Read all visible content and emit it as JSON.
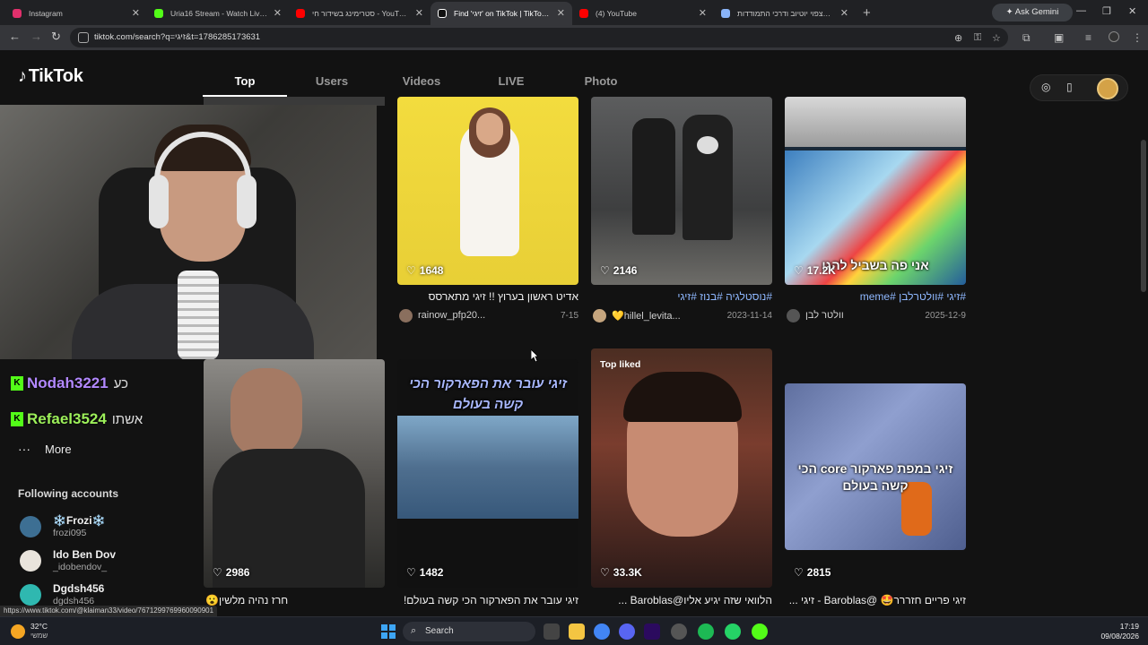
{
  "browser": {
    "tabs": [
      {
        "label": "Instagram",
        "color": "#e1306c"
      },
      {
        "label": "Uria16 Stream - Watch Live on Kick",
        "color": "#53fc18"
      },
      {
        "label": "סטרימינג בשידור חי - YouTube Studio",
        "color": "#ff0000"
      },
      {
        "label": "Find 'זיגי' on TikTok | TikTok Search",
        "color": "#ffffff"
      },
      {
        "label": "(4) YouTube",
        "color": "#ff0000"
      },
      {
        "label": "ירידה בצפוי יוטיוב ודרכי התמודדות",
        "color": "#8ab4f8"
      }
    ],
    "ask_gemini": "Ask Gemini",
    "url": "tiktok.com/search?q=זיגי&t=1786285173631",
    "status_url": "https://www.tiktok.com/@klaiman33/video/7671299769960090901"
  },
  "tiktok": {
    "logo": "TikTok",
    "search_tabs": [
      "Top",
      "Users",
      "Videos",
      "LIVE",
      "Photo"
    ],
    "active_tab": "Top",
    "sidebar": {
      "chat": [
        {
          "name": "Nodah3221",
          "msg": "כע"
        },
        {
          "name": "Refael3524",
          "msg": "אשתו"
        }
      ],
      "more": "More",
      "following_header": "Following accounts",
      "accounts": [
        {
          "name": "❄️Frozi❄️",
          "handle": "frozi095"
        },
        {
          "name": "Ido Ben Dov",
          "handle": "_idobendov_"
        },
        {
          "name": "Dgdsh456",
          "handle": "dgdsh456"
        }
      ]
    },
    "videos": [
      {
        "likes": "1648",
        "caption": "אדיט ראשון בערוץ !! זיגי מתארסס",
        "user": "rainow_pfp20...",
        "date": "7-15"
      },
      {
        "likes": "2146",
        "caption": "#נוסטלגיה #בנוז #זיגי",
        "user": "💛hillel_levita...",
        "date": "2023-11-14"
      },
      {
        "likes": "17.2K",
        "caption": "#זיגי #וולטרלבן #meme",
        "user": "וולטר לבן",
        "date": "2025-12-9",
        "overlay": "אני פה בשביל להגן"
      },
      {
        "likes": "2986",
        "caption": "חרז נהיה מלשין😮",
        "user": "",
        "date": ""
      },
      {
        "likes": "1482",
        "caption": "זיגי עובר את הפארקור הכי קשה בעולם!",
        "user": "",
        "date": "",
        "overlay": "זיגי עובר את הפארקור הכי קשה בעולם"
      },
      {
        "likes": "33.3K",
        "caption": "הלוואי שזה יגיע אליו@Baroblas ...",
        "user": "",
        "date": "",
        "badge": "Top liked"
      },
      {
        "likes": "2815",
        "caption": "זיגי פריים חזררר🤩 @Baroblas - זיגי ...",
        "user": "",
        "date": "",
        "overlay": "זיגי במפת פארקור core הכי קשה בעולם"
      }
    ]
  },
  "taskbar": {
    "temp": "32°C",
    "condition": "שמשי",
    "search": "Search",
    "time": "17:19",
    "date": "09/08/2026"
  }
}
